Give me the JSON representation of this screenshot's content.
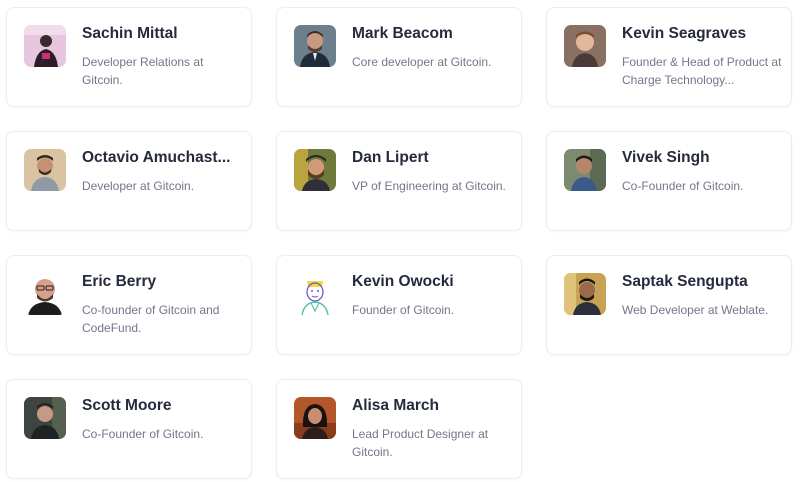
{
  "people": [
    {
      "name": "Sachin Mittal",
      "role": "Developer Relations at Gitcoin.",
      "avatar_icon": "person-photo-icon"
    },
    {
      "name": "Mark Beacom",
      "role": "Core developer at Gitcoin.",
      "avatar_icon": "person-photo-icon"
    },
    {
      "name": "Kevin Seagraves",
      "role": "Founder & Head of Product at Charge Technology...",
      "avatar_icon": "person-photo-icon"
    },
    {
      "name": "Octavio Amuchast...",
      "role": "Developer at Gitcoin.",
      "avatar_icon": "person-photo-icon"
    },
    {
      "name": "Dan Lipert",
      "role": "VP of Engineering at Gitcoin.",
      "avatar_icon": "person-photo-icon"
    },
    {
      "name": "Vivek Singh",
      "role": "Co-Founder of Gitcoin.",
      "avatar_icon": "person-photo-icon"
    },
    {
      "name": "Eric Berry",
      "role": "Co-founder of Gitcoin and CodeFund.",
      "avatar_icon": "person-photo-icon"
    },
    {
      "name": "Kevin Owocki",
      "role": "Founder of Gitcoin.",
      "avatar_icon": "person-illustration-icon"
    },
    {
      "name": "Saptak Sengupta",
      "role": "Web Developer at Weblate.",
      "avatar_icon": "person-photo-icon"
    },
    {
      "name": "Scott Moore",
      "role": "Co-Founder of Gitcoin.",
      "avatar_icon": "person-photo-icon"
    },
    {
      "name": "Alisa March",
      "role": "Lead Product Designer at Gitcoin.",
      "avatar_icon": "person-photo-icon"
    }
  ],
  "colors": {
    "name_text": "#252a3d",
    "role_text": "#72778a",
    "card_border": "#ececf1"
  }
}
